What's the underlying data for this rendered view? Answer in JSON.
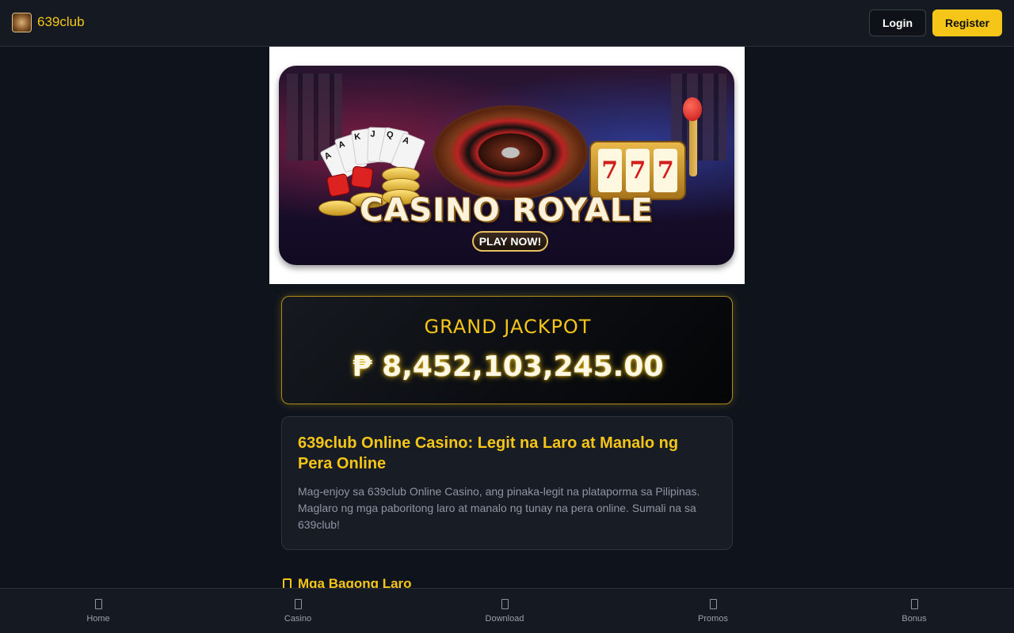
{
  "header": {
    "brand": "639club",
    "login_label": "Login",
    "register_label": "Register"
  },
  "banner": {
    "title": "CASINO ROYALE",
    "cta": "PLAY NOW!",
    "cards": [
      "A",
      "A",
      "K",
      "J",
      "Q",
      "A"
    ],
    "reels": [
      "7",
      "7",
      "7"
    ]
  },
  "jackpot": {
    "title": "GRAND JACKPOT",
    "amount": "₱ 8,452,103,245.00"
  },
  "info": {
    "heading": "639club Online Casino: Legit na Laro at Manalo ng Pera Online",
    "body": "Mag-enjoy sa 639club Online Casino, ang pinaka-legit na plataporma sa Pilipinas. Maglaro ng mga paboritong laro at manalo ng tunay na pera online. Sumali na sa 639club!"
  },
  "section": {
    "title": "Mga Bagong Laro"
  },
  "bottom_nav": {
    "items": [
      {
        "label": "Home",
        "icon": "home-icon"
      },
      {
        "label": "Casino",
        "icon": "casino-icon"
      },
      {
        "label": "Download",
        "icon": "download-icon"
      },
      {
        "label": "Promos",
        "icon": "promos-icon"
      },
      {
        "label": "Bonus",
        "icon": "bonus-icon"
      }
    ]
  },
  "colors": {
    "accent": "#f5c518",
    "background": "#0f141c",
    "header": "#151a22"
  }
}
